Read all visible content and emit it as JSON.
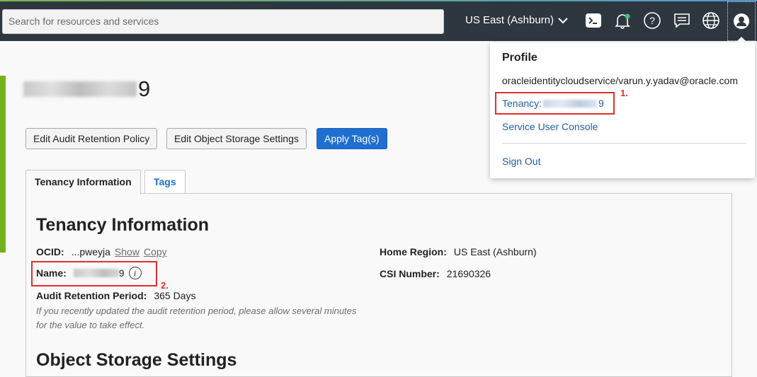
{
  "topbar": {
    "search_placeholder": "Search for resources and services",
    "region": "US East (Ashburn)",
    "icons": [
      "cloud-shell-icon",
      "bell-icon",
      "help-icon",
      "feedback-icon",
      "globe-icon",
      "profile-icon"
    ],
    "accent_color": "#2e3740",
    "notification_color": "#3ec47a"
  },
  "resource": {
    "title_suffix": "9"
  },
  "actions": {
    "edit_audit": "Edit Audit Retention Policy",
    "edit_storage": "Edit Object Storage Settings",
    "apply_tags": "Apply Tag(s)"
  },
  "tabs": [
    {
      "label": "Tenancy Information",
      "active": true
    },
    {
      "label": "Tags",
      "active": false
    }
  ],
  "tenancy_info": {
    "heading": "Tenancy Information",
    "ocid_label": "OCID:",
    "ocid_value": "...pweyja",
    "show_link": "Show",
    "copy_link": "Copy",
    "name_label": "Name:",
    "name_suffix": "9",
    "audit_label": "Audit Retention Period:",
    "audit_value": "365 Days",
    "hint": "If you recently updated the audit retention period, please allow several minutes for the value to take effect.",
    "home_region_label": "Home Region:",
    "home_region_value": "US East (Ashburn)",
    "csi_label": "CSI Number:",
    "csi_value": "21690326"
  },
  "object_storage": {
    "heading": "Object Storage Settings"
  },
  "profile_menu": {
    "title": "Profile",
    "user": "oracleidentitycloudservice/varun.y.yadav@oracle.com",
    "tenancy_label": "Tenancy:",
    "tenancy_suffix": "9",
    "service_console": "Service User Console",
    "sign_out": "Sign Out"
  },
  "annotations": {
    "label_1": "1.",
    "label_2": "2.",
    "highlight_color": "#e02f2f"
  }
}
